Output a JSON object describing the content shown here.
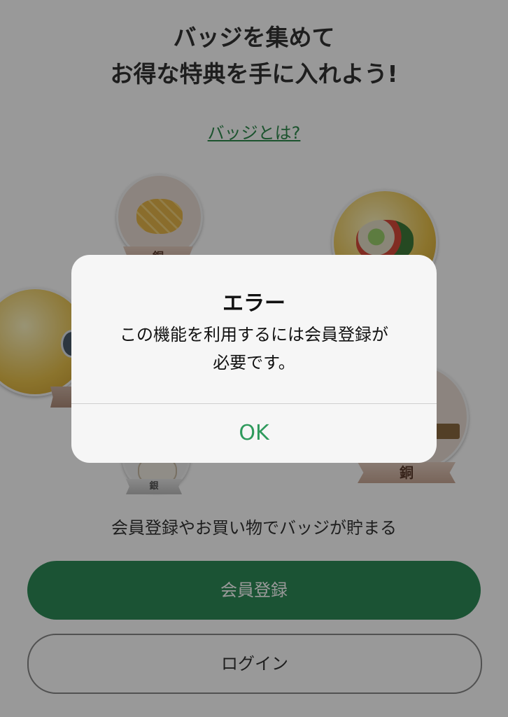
{
  "headline": {
    "line1": "バッジを集めて",
    "line2": "お得な特典を手に入れよう!"
  },
  "what_link": "バッジとは?",
  "badges": [
    {
      "name": "melon-pan",
      "rank": "銅"
    },
    {
      "name": "salad",
      "rank": ""
    },
    {
      "name": "disc",
      "rank": ""
    },
    {
      "name": "bento",
      "rank": "銅"
    },
    {
      "name": "dumpling",
      "rank": "銀"
    }
  ],
  "sub_caption": "会員登録やお買い物でバッジが貯まる",
  "buttons": {
    "register": "会員登録",
    "login": "ログイン"
  },
  "alert": {
    "title": "エラー",
    "message_line1": "この機能を利用するには会員登録が",
    "message_line2": "必要です。",
    "ok": "OK"
  },
  "colors": {
    "brand_green": "#2e8b57",
    "ok_green": "#2e9a5c",
    "link_green": "#2f8a4d"
  }
}
